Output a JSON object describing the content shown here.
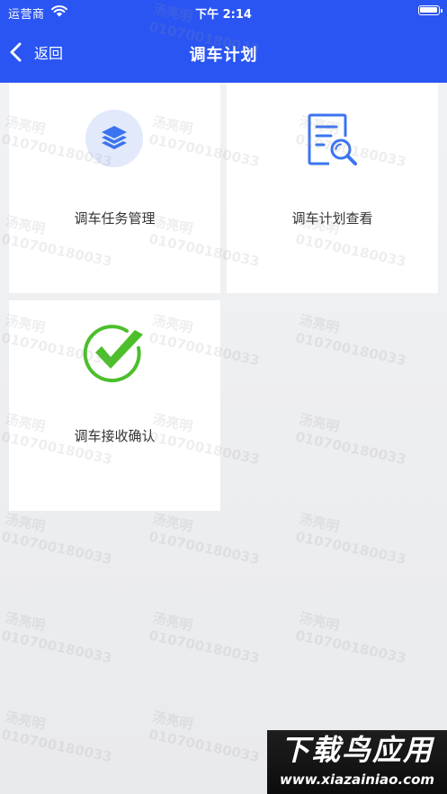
{
  "status_bar": {
    "carrier": "运营商",
    "time": "下午 2:14"
  },
  "nav": {
    "back_label": "返回",
    "title": "调车计划"
  },
  "cards": [
    {
      "label": "调车任务管理",
      "icon": "layers-icon"
    },
    {
      "label": "调车计划查看",
      "icon": "document-search-icon"
    },
    {
      "label": "调车接收确认",
      "icon": "check-circle-icon"
    }
  ],
  "watermark": {
    "name": "汤亮明",
    "number": "010700180033"
  },
  "corner_logo": {
    "text": "下载鸟应用",
    "url": "www.xiazainiao.com"
  },
  "colors": {
    "header": "#2a55f3",
    "icon_blue": "#3b74f0",
    "icon_green": "#4cbf2b"
  }
}
